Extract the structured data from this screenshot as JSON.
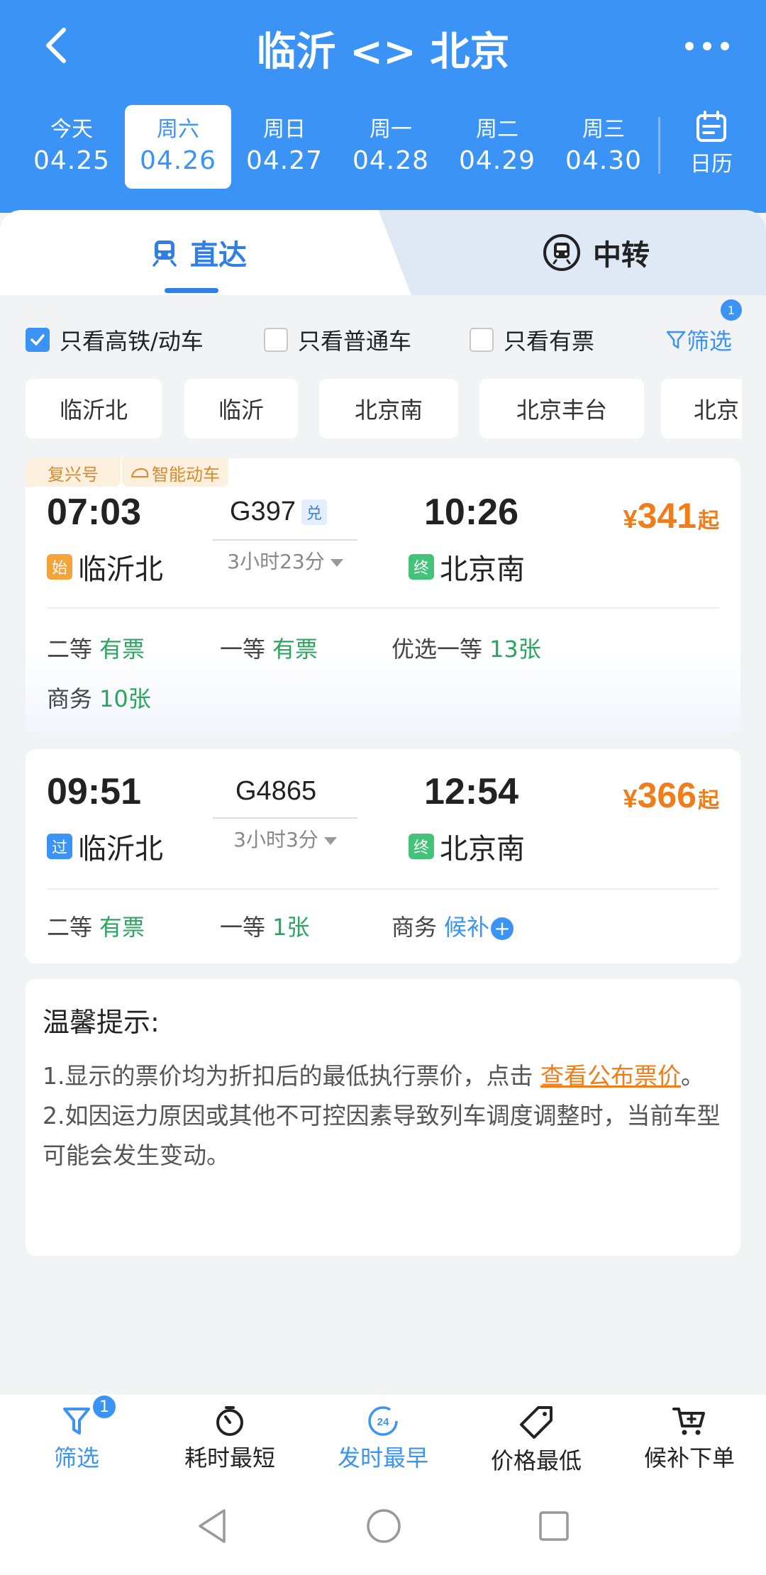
{
  "header": {
    "title": "临沂 <> 北京",
    "calendar_label": "日历"
  },
  "dates": [
    {
      "weekday": "今天",
      "date": "04.25",
      "active": false
    },
    {
      "weekday": "周六",
      "date": "04.26",
      "active": true
    },
    {
      "weekday": "周日",
      "date": "04.27",
      "active": false
    },
    {
      "weekday": "周一",
      "date": "04.28",
      "active": false
    },
    {
      "weekday": "周二",
      "date": "04.29",
      "active": false
    },
    {
      "weekday": "周三",
      "date": "04.30",
      "active": false
    }
  ],
  "tabs": {
    "direct": "直达",
    "transfer": "中转"
  },
  "filters": {
    "high_speed": "只看高铁/动车",
    "normal": "只看普通车",
    "available": "只看有票",
    "filter_label": "筛选",
    "filter_badge": "1"
  },
  "station_chips": [
    "临沂北",
    "临沂",
    "北京南",
    "北京丰台",
    "北京"
  ],
  "trains": [
    {
      "tags": [
        "复兴号",
        "智能动车"
      ],
      "depart_time": "07:03",
      "train_no": "G397",
      "exchange_badge": "兑",
      "arrive_time": "10:26",
      "duration": "3小时23分",
      "from_badge": "始",
      "from_station": "临沂北",
      "to_badge": "终",
      "to_station": "北京南",
      "price_symbol": "¥",
      "price": "341",
      "price_suffix": "起",
      "seats": [
        {
          "name": "二等",
          "status": "有票"
        },
        {
          "name": "一等",
          "status": "有票"
        },
        {
          "name": "优选一等",
          "status": "13张"
        },
        {
          "name": "商务",
          "status": "10张"
        }
      ]
    },
    {
      "tags": [],
      "depart_time": "09:51",
      "train_no": "G4865",
      "exchange_badge": "",
      "arrive_time": "12:54",
      "duration": "3小时3分",
      "from_badge": "过",
      "from_station": "临沂北",
      "to_badge": "终",
      "to_station": "北京南",
      "price_symbol": "¥",
      "price": "366",
      "price_suffix": "起",
      "seats": [
        {
          "name": "二等",
          "status": "有票"
        },
        {
          "name": "一等",
          "status": "1张"
        },
        {
          "name": "商务",
          "status": "候补"
        }
      ]
    }
  ],
  "notice": {
    "title": "温馨提示:",
    "item1_prefix": "1.显示的票价均为折扣后的最低执行票价，点击 ",
    "item1_link": "查看公布票价",
    "item1_suffix": "。",
    "item2": "2.如因运力原因或其他不可控因素导致列车调度调整时，当前车型可能会发生变动。"
  },
  "bottom_bar": [
    {
      "label": "筛选",
      "icon": "filter-icon",
      "active": true,
      "badge": "1"
    },
    {
      "label": "耗时最短",
      "icon": "timer-icon",
      "active": false
    },
    {
      "label": "发时最早",
      "icon": "clock-24-icon",
      "active": true
    },
    {
      "label": "价格最低",
      "icon": "price-tag-icon",
      "active": false
    },
    {
      "label": "候补下单",
      "icon": "cart-plus-icon",
      "active": false
    }
  ],
  "colors": {
    "primary": "#3a93f5",
    "price": "#f07c1a",
    "available": "#2aa55f"
  }
}
